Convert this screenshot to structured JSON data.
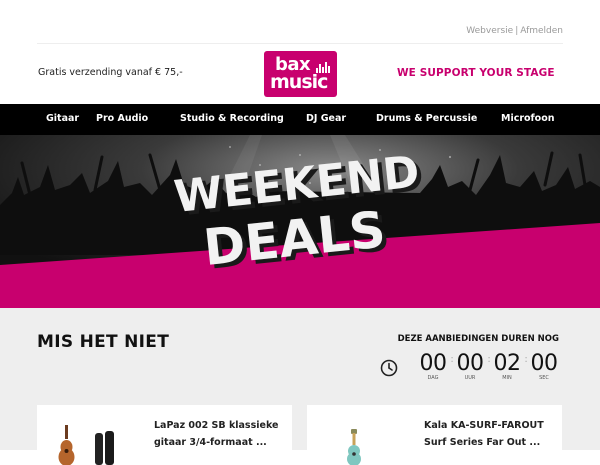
{
  "top_links": {
    "webversion": "Webversie",
    "separator": "|",
    "unsubscribe": "Afmelden"
  },
  "header": {
    "shipping": "Gratis verzending vanaf € 75,-",
    "logo_line1": "bax",
    "logo_line2": "music",
    "slogan": "WE SUPPORT YOUR STAGE"
  },
  "nav": {
    "items": [
      {
        "label": "Gitaar"
      },
      {
        "label": "Pro Audio"
      },
      {
        "label": "Studio & Recording"
      },
      {
        "label": "DJ Gear"
      },
      {
        "label": "Drums & Percussie"
      },
      {
        "label": "Microfoon"
      }
    ]
  },
  "banner": {
    "line1": "WEEKEND",
    "line2": "DEALS"
  },
  "countdown": {
    "heading": "MIS HET NIET",
    "subheading": "DEZE AANBIEDINGEN DUREN NOG",
    "units": [
      {
        "value": "00",
        "label": "DAG"
      },
      {
        "value": "00",
        "label": "UUR"
      },
      {
        "value": "02",
        "label": "MIN"
      },
      {
        "value": "00",
        "label": "SEC"
      }
    ],
    "separator": ":"
  },
  "products": [
    {
      "title_line1": "LaPaz 002 SB klassieke",
      "title_line2": "gitaar 3/4-formaat ..."
    },
    {
      "title_line1": "Kala KA-SURF-FAROUT",
      "title_line2": "Surf Series Far Out ..."
    }
  ],
  "colors": {
    "brand": "#c8006e",
    "nav_bg": "#000000",
    "section_bg": "#eeeeee"
  }
}
